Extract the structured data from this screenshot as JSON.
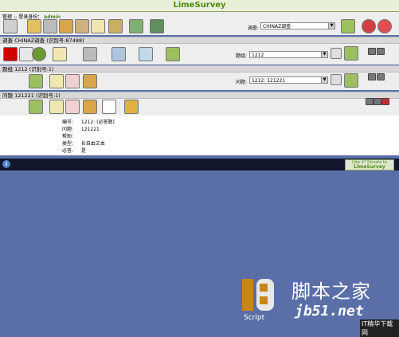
{
  "app": {
    "title": "LimeSurvey"
  },
  "admin_bar": {
    "admin_label": "管理",
    "separator": "--",
    "login_label": "登录身份：",
    "username": "admin",
    "survey_label": "调查:",
    "survey_select_value": "CHINAZ调查"
  },
  "survey_bar": {
    "heading": "调查 CHINAZ调查 (识别号:87488)",
    "group_label": "题组:",
    "group_select_value": "1212"
  },
  "group_bar": {
    "heading": "题组 1212 (识别号:1)",
    "question_label": "问题:",
    "question_select_value": "1212: 121221"
  },
  "question_bar": {
    "heading": "问题 121221 (识别号:1)"
  },
  "question_details": {
    "rows": [
      {
        "key": "编号:",
        "value": "1212: (必答题)"
      },
      {
        "key": "问题:",
        "value": "121221"
      },
      {
        "key": "帮助:",
        "value": ""
      },
      {
        "key": "类型:",
        "value": "长自由文本"
      },
      {
        "key": "必答:",
        "value": "是"
      }
    ]
  },
  "footer": {
    "info_label": "i",
    "donate_line1": "Like it? Donate to",
    "donate_line2": "LimeSurvey"
  },
  "watermark": {
    "logo_caption": "Script",
    "site_name": "脚本之家",
    "site_url": "jb51.net",
    "small_text": "IT精华下载网"
  },
  "colors": {
    "brand_green": "#4e8a15",
    "page_bg": "#5a6fa8",
    "footer_bg": "#12162a"
  }
}
